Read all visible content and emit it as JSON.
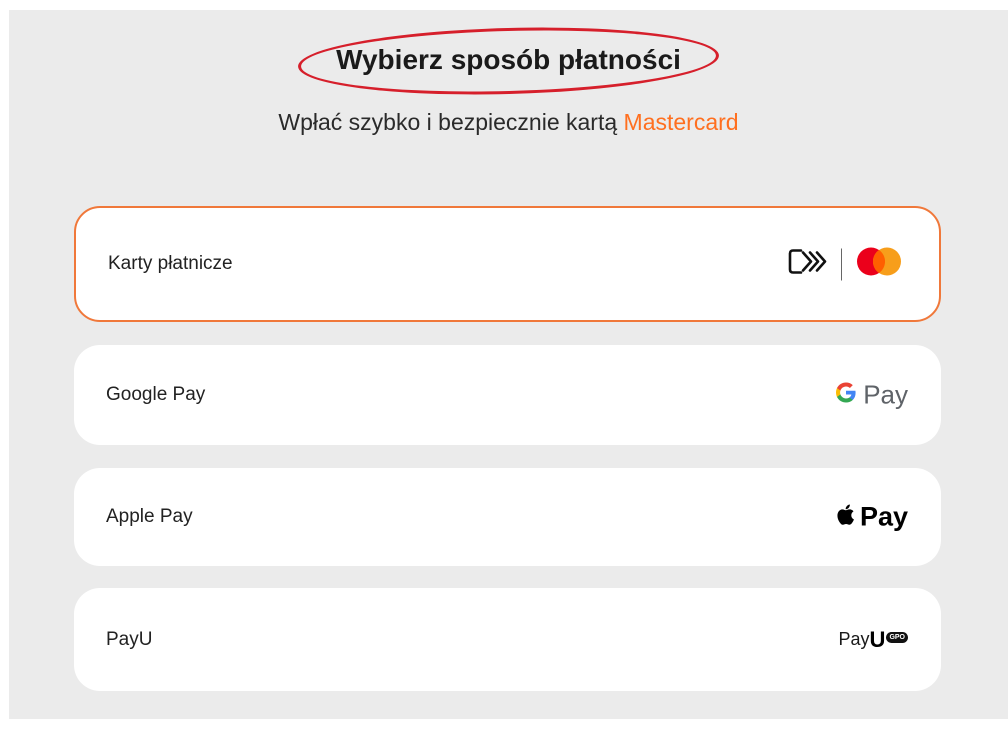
{
  "header": {
    "title": "Wybierz sposób płatności",
    "subtitle_prefix": "Wpłać szybko i bezpiecznie kartą ",
    "subtitle_brand": "Mastercard"
  },
  "options": [
    {
      "label": "Karty płatnicze",
      "selected": true,
      "icons": [
        "contactless-card-icon",
        "mastercard-logo-icon"
      ]
    },
    {
      "label": "Google Pay",
      "selected": false,
      "logo_text": "Pay",
      "icons": [
        "google-g-icon"
      ]
    },
    {
      "label": "Apple Pay",
      "selected": false,
      "logo_text": "Pay",
      "icons": [
        "apple-logo-icon"
      ]
    },
    {
      "label": "PayU",
      "selected": false,
      "logo_text_prefix": "Pay",
      "logo_text_u": "U",
      "logo_badge": "GPO",
      "icons": [
        "payu-logo-icon"
      ]
    }
  ],
  "colors": {
    "accent": "#ff6f1f",
    "selected_border": "#f0783a",
    "annotation_ring": "#d61f2b",
    "background": "#ebebeb",
    "card": "#ffffff",
    "mastercard_red": "#eb001b",
    "mastercard_orange": "#f79e1b"
  }
}
